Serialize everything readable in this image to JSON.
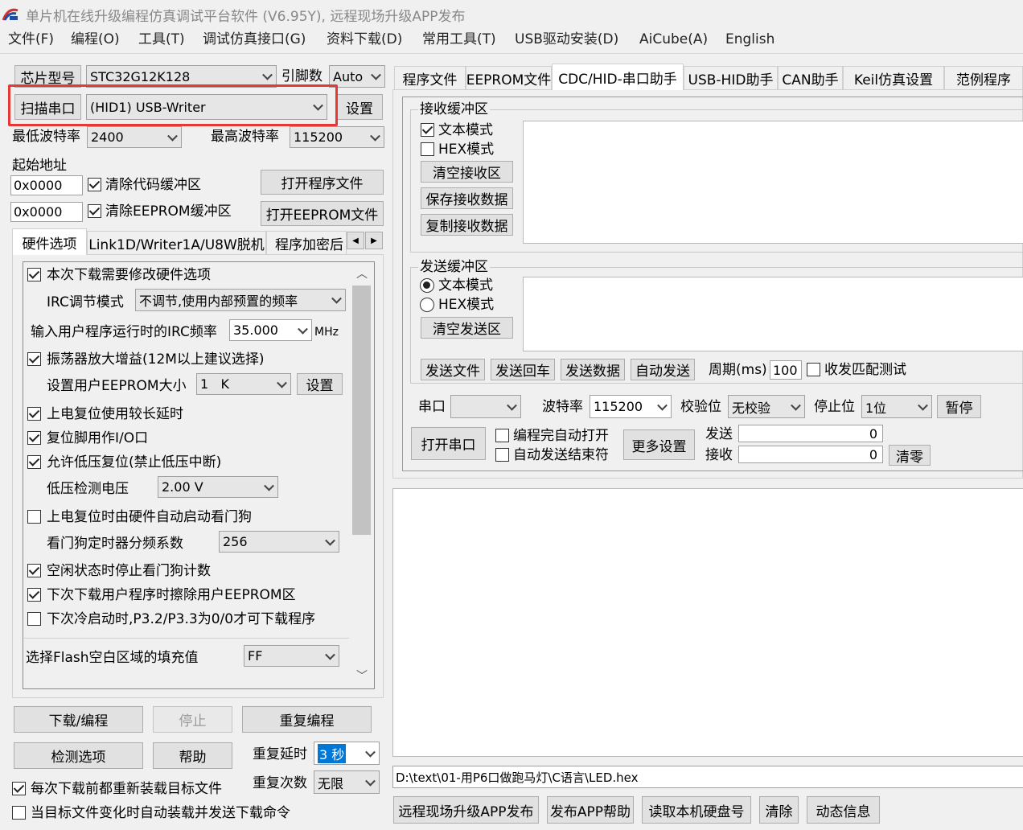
{
  "window": {
    "title": "单片机在线升级编程仿真调试平台软件 (V6.95Y), 远程现场升级APP发布"
  },
  "menu": [
    "文件(F)",
    "编程(O)",
    "工具(T)",
    "调试仿真接口(G)",
    "资料下载(D)",
    "常用工具(T)",
    "USB驱动安装(D)",
    "AiCube(A)",
    "English"
  ],
  "left": {
    "chip_label": "芯片型号",
    "chip_value": "STC32G12K128",
    "pins_label": "引脚数",
    "pins_value": "Auto",
    "scan_port_button": "扫描串口",
    "port_value": "(HID1) USB-Writer",
    "settings_button": "设置",
    "min_baud_label": "最低波特率",
    "min_baud_value": "2400",
    "max_baud_label": "最高波特率",
    "max_baud_value": "115200",
    "start_addr_label": "起始地址",
    "addr1": "0x0000",
    "addr2": "0x0000",
    "clear_code_buffer": "清除代码缓冲区",
    "clear_eeprom_buffer": "清除EEPROM缓冲区",
    "open_program_file": "打开程序文件",
    "open_eeprom_file": "打开EEPROM文件",
    "subtabs": [
      "硬件选项",
      "Link1D/Writer1A/U8W脱机",
      "程序加密后"
    ],
    "hw": {
      "modify_hw": "本次下载需要修改硬件选项",
      "irc_mode_label": "IRC调节模式",
      "irc_mode_value": "不调节,使用内部预置的频率",
      "irc_freq_label": "输入用户程序运行时的IRC频率",
      "irc_freq_value": "35.000",
      "irc_freq_unit": "MHz",
      "osc_gain": "振荡器放大增益(12M以上建议选择)",
      "eeprom_size_label": "设置用户EEPROM大小",
      "eeprom_size_value": "1   K",
      "eeprom_set_button": "设置",
      "long_delay": "上电复位使用较长延时",
      "reset_io": "复位脚用作I/O口",
      "lvd_reset": "允许低压复位(禁止低压中断)",
      "lvd_voltage_label": "低压检测电压",
      "lvd_voltage_value": "2.00 V",
      "wdt_auto": "上电复位时由硬件自动启动看门狗",
      "wdt_div_label": "看门狗定时器分频系数",
      "wdt_div_value": "256",
      "wdt_idle_stop": "空闲状态时停止看门狗计数",
      "erase_eeprom": "下次下载用户程序时擦除用户EEPROM区",
      "cold_boot": "下次冷启动时,P3.2/P3.3为0/0才可下载程序",
      "flash_fill_label": "选择Flash空白区域的填充值",
      "flash_fill_value": "FF"
    },
    "download_button": "下载/编程",
    "stop_button": "停止",
    "reprogram_button": "重复编程",
    "check_options_button": "检测选项",
    "help_button": "帮助",
    "repeat_delay_label": "重复延时",
    "repeat_delay_value": "3 秒",
    "repeat_count_label": "重复次数",
    "repeat_count_value": "无限",
    "reload_before_download": "每次下载前都重新装载目标文件",
    "auto_reload_send": "当目标文件变化时自动装载并发送下载命令"
  },
  "right": {
    "tabs": [
      "程序文件",
      "EEPROM文件",
      "CDC/HID-串口助手",
      "USB-HID助手",
      "CAN助手",
      "Keil仿真设置",
      "范例程序"
    ],
    "recv": {
      "group_title": "接收缓冲区",
      "text_mode": "文本模式",
      "hex_mode": "HEX模式",
      "clear_button": "清空接收区",
      "save_button": "保存接收数据",
      "copy_button": "复制接收数据"
    },
    "send": {
      "group_title": "发送缓冲区",
      "text_mode": "文本模式",
      "hex_mode": "HEX模式",
      "clear_button": "清空发送区",
      "send_file_button": "发送文件",
      "send_cr_button": "发送回车",
      "send_data_button": "发送数据",
      "auto_send_button": "自动发送",
      "period_label": "周期(ms)",
      "period_value": "100",
      "match_test": "收发匹配测试"
    },
    "serial": {
      "port_label": "串口",
      "port_value": "",
      "baud_label": "波特率",
      "baud_value": "115200",
      "parity_label": "校验位",
      "parity_value": "无校验",
      "stop_label": "停止位",
      "stop_value": "1位",
      "pause_button": "暂停",
      "open_port_button": "打开串口",
      "auto_open": "编程完自动打开",
      "auto_send_end": "自动发送结束符",
      "more_settings_button": "更多设置",
      "send_count_label": "发送",
      "send_count": "0",
      "recv_count_label": "接收",
      "recv_count": "0",
      "clear_count_button": "清零"
    },
    "file_path": "D:\\text\\01-用P6口做跑马灯\\C语言\\LED.hex",
    "bottom_buttons": [
      "远程现场升级APP发布",
      "发布APP帮助",
      "读取本机硬盘号",
      "清除",
      "动态信息"
    ]
  },
  "colors": {
    "highlight": "#e53935",
    "selection": "#0078d7"
  }
}
